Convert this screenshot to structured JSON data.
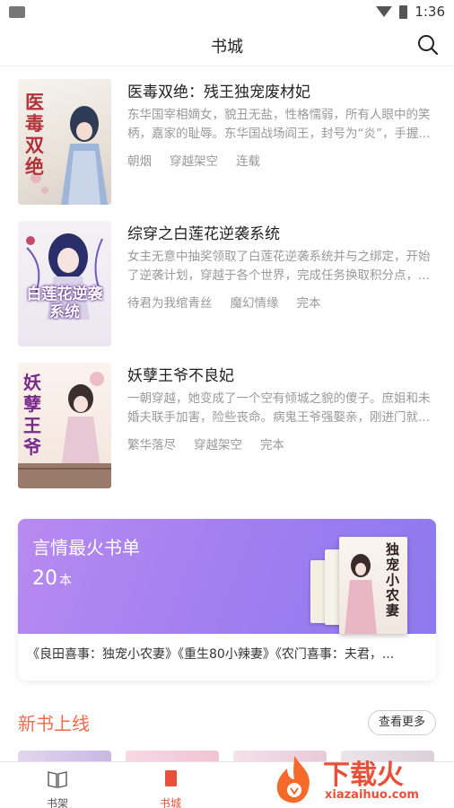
{
  "status": {
    "time": "1:36"
  },
  "header": {
    "title": "书城"
  },
  "books": [
    {
      "title": "医毒双绝：残王独宠废材妃",
      "desc": "东华国宰相嫡女，貌丑无盐，性格懦弱，所有人眼中的笑柄，嘉家的耻辱。东华国战场阎王，封号为“炎”，手握...",
      "author": "朝烟",
      "category": "穿越架空",
      "status": "连载",
      "cover_text": "医毒双绝"
    },
    {
      "title": "综穿之白莲花逆袭系统",
      "desc": "女主无意中抽奖领取了白莲花逆袭系统并与之绑定，开始了逆袭计划，穿越于各个世界，完成任务换取积分点，...",
      "author": "待君为我绾青丝",
      "category": "魔幻情缘",
      "status": "完本",
      "cover_text": "白莲花逆袭系统"
    },
    {
      "title": "妖孽王爷不良妃",
      "desc": "一朝穿越，她变成了一个空有倾城之貌的傻子。庶姐和未婚夫联手加害，险些丧命。病鬼王爷强娶亲，刚进门就...",
      "author": "繁华落尽",
      "category": "穿越架空",
      "status": "完本",
      "cover_text": "妖孽王爷"
    }
  ],
  "booklist": {
    "title": "言情最火书单",
    "count": "20",
    "unit": "本",
    "books_text": "《良田喜事：独宠小农妻》《重生80小辣妻》《农门喜事：夫君，...",
    "cover_text": "独宠小农妻"
  },
  "new_books": {
    "title": "新书上线",
    "more_label": "查看更多"
  },
  "tabs": [
    {
      "label": "书架"
    },
    {
      "label": "书城"
    }
  ],
  "watermark": {
    "text": "下载火",
    "sub": "xiazaihuo.com"
  },
  "colors": {
    "accent": "#f06a4a",
    "tab_active": "#e8503a",
    "card_gradient_start": "#b88af0",
    "card_gradient_end": "#8d79ee"
  }
}
